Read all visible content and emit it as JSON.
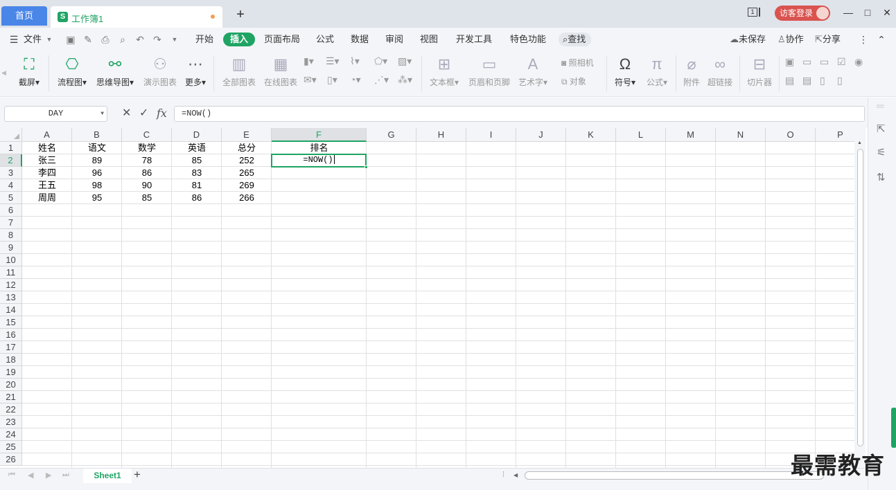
{
  "titlebar": {
    "home_tab": "首页",
    "doc_icon": "S",
    "doc_name": "工作簿1",
    "new_tab": "+",
    "window_count": "1",
    "guest_login": "访客登录",
    "minimize": "—",
    "maximize": "□",
    "close": "✕"
  },
  "menubar": {
    "file": "文件",
    "tabs": [
      "开始",
      "插入",
      "页面布局",
      "公式",
      "数据",
      "审阅",
      "视图",
      "开发工具",
      "特色功能"
    ],
    "active_tab": "插入",
    "search": "查找",
    "unsaved": "未保存",
    "collab": "协作",
    "share": "分享"
  },
  "ribbon": {
    "screenshot": "截屏",
    "flowchart": "流程图",
    "mindmap": "思维导图",
    "demo_chart": "演示图表",
    "more": "更多",
    "all_charts": "全部图表",
    "online_chart": "在线图表",
    "textbox": "文本框",
    "header_footer": "页眉和页脚",
    "wordart": "艺术字",
    "camera": "照相机",
    "object": "对象",
    "symbol": "符号",
    "formula": "公式",
    "attachment": "附件",
    "hyperlink": "超链接",
    "slicer": "切片器"
  },
  "formulabar": {
    "name_box": "DAY",
    "cancel": "✕",
    "confirm": "✓",
    "fx": "fx",
    "formula": "=NOW()"
  },
  "grid": {
    "columns": [
      "A",
      "B",
      "C",
      "D",
      "E",
      "F",
      "G",
      "H",
      "I",
      "J",
      "K",
      "L",
      "M",
      "N",
      "O",
      "P"
    ],
    "row_count": 26,
    "selected_column": "F",
    "selected_row": 2,
    "headers": [
      "姓名",
      "语文",
      "数学",
      "英语",
      "总分",
      "排名"
    ],
    "rows": [
      [
        "张三",
        "89",
        "78",
        "85",
        "252"
      ],
      [
        "李四",
        "96",
        "86",
        "83",
        "265"
      ],
      [
        "王五",
        "98",
        "90",
        "81",
        "269"
      ],
      [
        "周周",
        "95",
        "85",
        "86",
        "266"
      ]
    ],
    "editing_cell_value": "=NOW()"
  },
  "sheets": {
    "tabs": [
      "Sheet1"
    ],
    "add": "+"
  },
  "watermark": "最需教育"
}
